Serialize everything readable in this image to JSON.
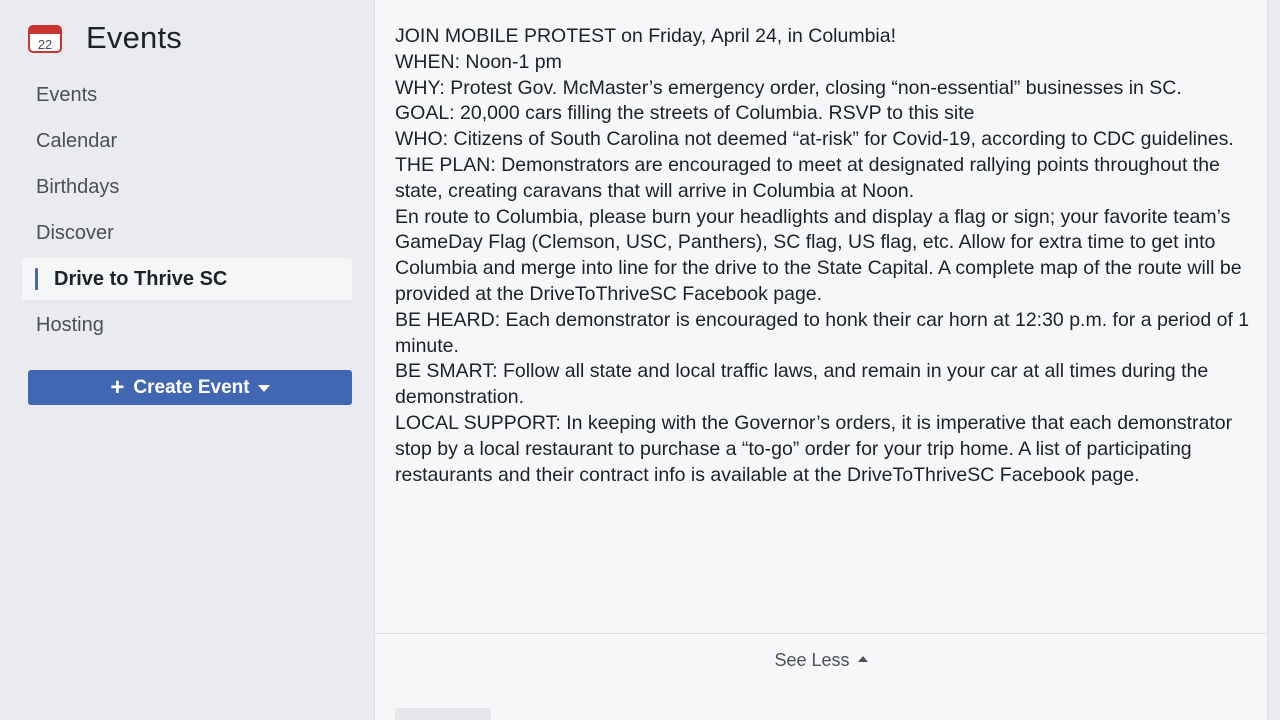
{
  "sidebar": {
    "icon": "calendar-icon",
    "icon_day": "22",
    "title": "Events",
    "items": [
      {
        "label": "Events",
        "active": false
      },
      {
        "label": "Calendar",
        "active": false
      },
      {
        "label": "Birthdays",
        "active": false
      },
      {
        "label": "Discover",
        "active": false
      },
      {
        "label": "Drive to Thrive SC",
        "active": true
      },
      {
        "label": "Hosting",
        "active": false
      }
    ],
    "create_button": {
      "label": "Create Event",
      "icon": "plus-icon",
      "dropdown_icon": "caret-down-icon"
    }
  },
  "description": {
    "lines": [
      "JOIN MOBILE PROTEST on Friday, April 24, in Columbia!",
      "WHEN: Noon-1 pm",
      "WHY:  Protest Gov. McMaster’s emergency order, closing “non-essential” businesses in SC.",
      "GOAL:  20,000 cars filling the streets of Columbia. RSVP to this site",
      "WHO:  Citizens of South Carolina not deemed “at-risk” for Covid-19, according to CDC guidelines.",
      "THE PLAN:  Demonstrators are encouraged to meet at designated rallying points throughout the state, creating caravans that will arrive in Columbia at Noon.",
      "En route to Columbia, please burn your headlights and display a flag or sign; your favorite team’s GameDay Flag (Clemson, USC, Panthers), SC flag, US flag, etc. Allow for extra time to get into Columbia and merge into line for the drive to the State Capital. A complete map of the route will be provided at the DriveToThriveSC Facebook page.",
      "BE HEARD: Each demonstrator is encouraged to honk their car horn at 12:30 p.m. for a period of 1 minute.",
      "BE SMART: Follow all state and local traffic laws, and remain in your car at all times during the demonstration.",
      "LOCAL SUPPORT: In keeping with the Governor’s orders, it is imperative that each demonstrator stop by a local restaurant to purchase a “to-go” order for your trip home. A list of participating restaurants and their contract info is available at the DriveToThriveSC Facebook page."
    ]
  },
  "see_less": {
    "label": "See Less",
    "icon": "caret-up-icon"
  },
  "colors": {
    "accent": "#4267b2",
    "page_background": "#e9ebee",
    "card_background": "#f6f7f9",
    "calendar_red": "#c9352f"
  }
}
